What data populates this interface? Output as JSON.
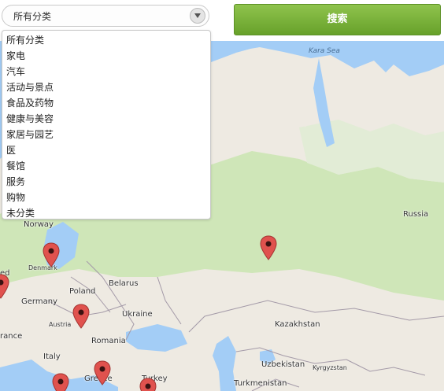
{
  "category_select": {
    "selected": "所有分类",
    "options": [
      "所有分类",
      "家电",
      "汽车",
      "活动与景点",
      "食品及药物",
      "健康与美容",
      "家居与园艺",
      "医",
      "餐馆",
      "服务",
      "购物",
      "未分类"
    ]
  },
  "search_button": {
    "label": "搜索"
  },
  "map": {
    "labels": {
      "kara_sea": "Kara Sea",
      "russia": "Russia",
      "norway": "Norway",
      "denmark": "Denmark",
      "belarus": "Belarus",
      "poland": "Poland",
      "germany": "Germany",
      "ukraine": "Ukraine",
      "austria": "Austria",
      "france_partial": "rance",
      "romania": "Romania",
      "kazakhstan": "Kazakhstan",
      "italy": "Italy",
      "uzbekistan": "Uzbekistan",
      "kyrgyzstan": "Kyrgyzstan",
      "greece_partial": "Greece",
      "turkey": "Turkey",
      "turkmenistan": "Turkmenistan",
      "uk_partial": "ed"
    },
    "colors": {
      "water": "#a3cdf6",
      "land": "#eeeae2",
      "forest": "#cfe6b8",
      "pin": "#e0524e"
    },
    "marker_icon": "map-pin-icon"
  }
}
